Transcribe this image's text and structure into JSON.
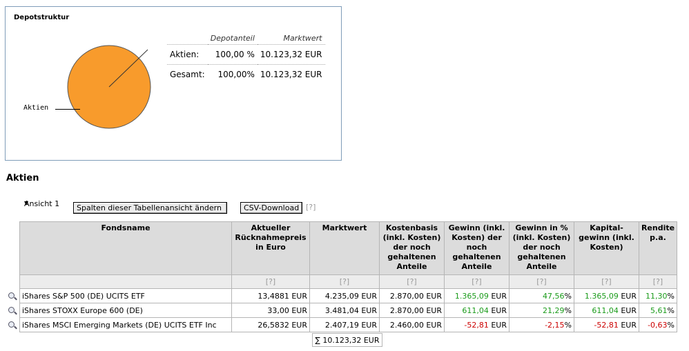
{
  "depot": {
    "title": "Depotstruktur",
    "pie_label": "Aktien",
    "pie_color": "#f89b2c",
    "summary_headers": [
      "Depotanteil",
      "Marktwert"
    ],
    "rows": [
      {
        "label": "Aktien:",
        "share": "100,00 %",
        "value": "10.123,32 EUR"
      },
      {
        "label": "Gesamt:",
        "share": "100,00%",
        "value": "10.123,32 EUR"
      }
    ]
  },
  "chart_data": {
    "type": "pie",
    "title": "",
    "categories": [
      "Aktien"
    ],
    "values": [
      100
    ]
  },
  "section_title": "Aktien",
  "controls": {
    "view_select": "Ansicht 1",
    "columns_button": "Spalten dieser Tabellenansicht ändern",
    "csv_button": "CSV-Download",
    "help": "[?]"
  },
  "table": {
    "headers": [
      "Fondsname",
      "Aktueller Rücknahmepreis in Euro",
      "Marktwert",
      "Kostenbasis (inkl. Kosten) der noch gehaltenen Anteile",
      "Gewinn (inkl. Kosten) der noch gehaltenen Anteile",
      "Gewinn in % (inkl. Kosten) der noch gehaltenen Anteile",
      "Kapital-gewinn (inkl. Kosten)",
      "Rendite p.a."
    ],
    "help": "[?]",
    "rows": [
      {
        "name": "iShares S&P 500 (DE) UCITS ETF",
        "price": "13,4881 EUR",
        "value": "4.235,09 EUR",
        "cost": "2.870,00 EUR",
        "gain": "1.365,09",
        "gain_unit": " EUR",
        "gain_pct": "47,56",
        "pct_unit": "%",
        "cap_gain": "1.365,09",
        "cap_unit": " EUR",
        "yield": "11,30",
        "yield_unit": "%",
        "sign": "pos"
      },
      {
        "name": "iShares STOXX Europe 600 (DE)",
        "price": "33,00 EUR",
        "value": "3.481,04 EUR",
        "cost": "2.870,00 EUR",
        "gain": "611,04",
        "gain_unit": " EUR",
        "gain_pct": "21,29",
        "pct_unit": "%",
        "cap_gain": "611,04",
        "cap_unit": " EUR",
        "yield": "5,61",
        "yield_unit": "%",
        "sign": "pos"
      },
      {
        "name": "iShares MSCI Emerging Markets (DE) UCITS ETF Inc",
        "price": "26,5832 EUR",
        "value": "2.407,19 EUR",
        "cost": "2.460,00 EUR",
        "gain": "-52,81",
        "gain_unit": " EUR",
        "gain_pct": "-2,15",
        "pct_unit": "%",
        "cap_gain": "-52,81",
        "cap_unit": " EUR",
        "yield": "-0,63",
        "yield_unit": "%",
        "sign": "neg"
      }
    ],
    "sum": "∑ 10.123,32 EUR"
  }
}
